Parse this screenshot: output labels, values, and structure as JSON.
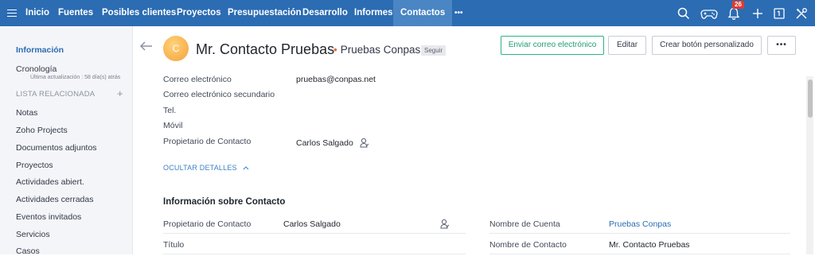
{
  "nav": {
    "items": [
      {
        "label": "Inicio"
      },
      {
        "label": "Fuentes"
      },
      {
        "label": "Posibles clientes"
      },
      {
        "label": "Proyectos"
      },
      {
        "label": "Presupuestación"
      },
      {
        "label": "Desarrollo"
      },
      {
        "label": "Informes"
      },
      {
        "label": "Contactos",
        "active": true
      }
    ],
    "more_label": "•••",
    "notification_count": "26",
    "icons": [
      "search-icon",
      "gamepad-icon",
      "bell-icon",
      "plus-icon",
      "calendar-icon",
      "tools-icon"
    ],
    "accent": "#2b6cb3",
    "active_bg": "#4a85c4"
  },
  "sidebar": {
    "info_label": "Información",
    "timeline_label": "Cronología",
    "timeline_sub": "Última actualización : 58 día(s) atrás",
    "related_header": "LISTA RELACIONADA",
    "items": [
      "Notas",
      "Zoho Projects",
      "Documentos adjuntos",
      "Proyectos",
      "Actividades abiert.",
      "Actividades cerradas",
      "Eventos invitados",
      "Servicios",
      "Casos"
    ]
  },
  "record": {
    "avatar_initial": "C",
    "name": "Mr. Contacto Pruebas",
    "account": "Pruebas Conpas",
    "follow_label": "Seguir",
    "buttons": {
      "email": "Enviar correo electrónico",
      "edit": "Editar",
      "custom": "Crear botón personalizado",
      "more": "•••"
    }
  },
  "details": [
    {
      "label": "Correo electrónico",
      "value": "pruebas@conpas.net"
    },
    {
      "label": "Correo electrónico secundario",
      "value": ""
    },
    {
      "label": "Tel.",
      "value": ""
    },
    {
      "label": "Móvil",
      "value": ""
    },
    {
      "label": "Propietario de Contacto",
      "value": "Carlos Salgado"
    }
  ],
  "hide_details_label": "OCULTAR DETALLES",
  "section": {
    "title": "Información sobre Contacto",
    "left": [
      {
        "label": "Propietario de Contacto",
        "value": "Carlos Salgado"
      },
      {
        "label": "Título",
        "value": ""
      }
    ],
    "right": [
      {
        "label": "Nombre de Cuenta",
        "value": "Pruebas Conpas"
      },
      {
        "label": "Nombre de Contacto",
        "value": "Mr. Contacto Pruebas"
      }
    ]
  }
}
